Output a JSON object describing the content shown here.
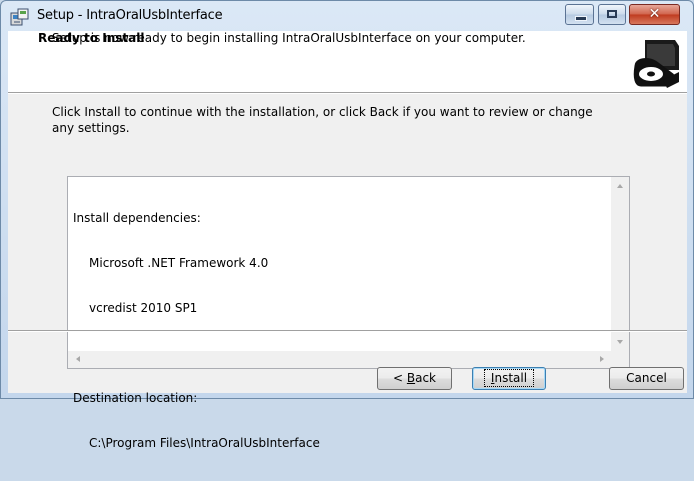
{
  "window": {
    "title": "Setup - IntraOralUsbInterface",
    "close_glyph": "✕"
  },
  "header": {
    "title": "Ready to Install",
    "subtitle": "Setup is now ready to begin installing IntraOralUsbInterface on your computer."
  },
  "body": {
    "intro": "Click Install to continue with the installation, or click Back if you want to review or change any settings.",
    "memo": {
      "dependencies_heading": "Install dependencies:",
      "dependencies": [
        "Microsoft .NET Framework 4.0",
        "vcredist 2010 SP1"
      ],
      "destination_heading": "Destination location:",
      "destination_path": "C:\\Program Files\\IntraOralUsbInterface"
    }
  },
  "buttons": {
    "back": {
      "prefix": "< ",
      "accel": "B",
      "rest": "ack"
    },
    "install": {
      "accel": "I",
      "rest": "nstall"
    },
    "cancel": {
      "label": "Cancel"
    }
  },
  "icons": {
    "title": "setup-installer-icon",
    "header": "install-disk-box-icon"
  }
}
